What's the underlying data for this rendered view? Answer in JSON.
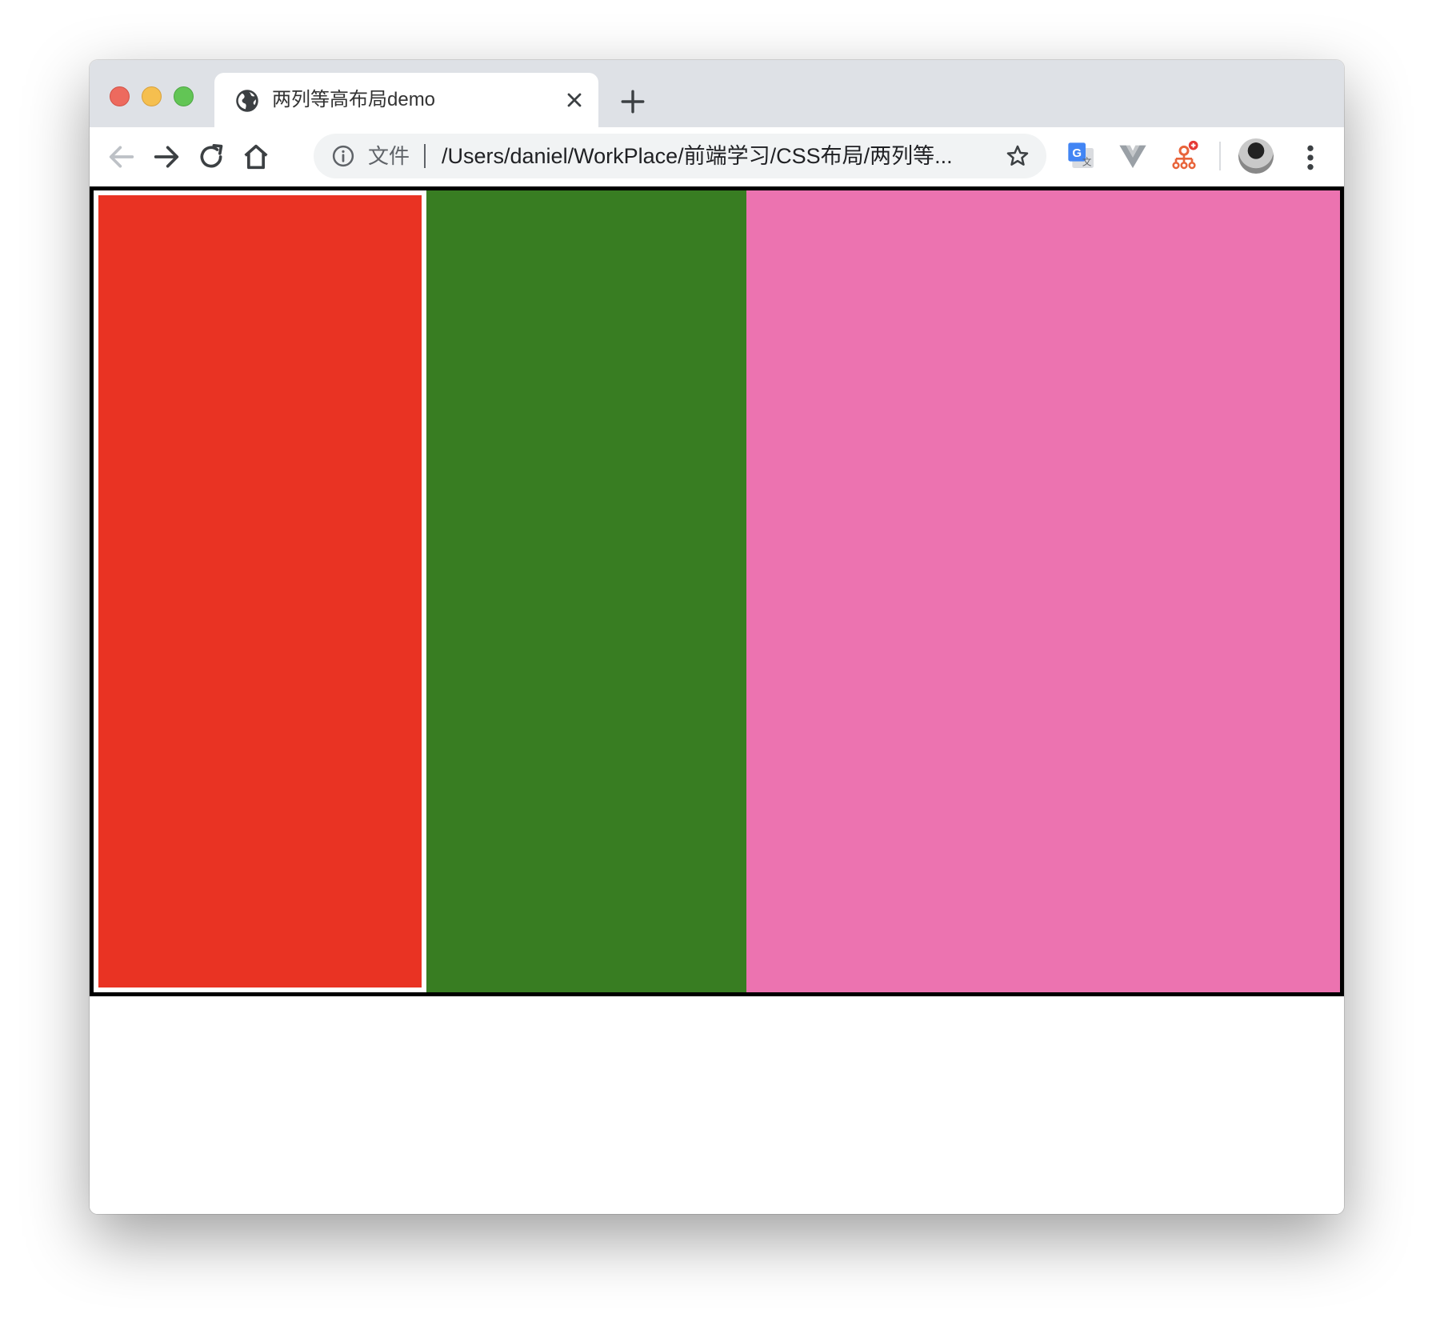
{
  "tab": {
    "title": "两列等高布局demo"
  },
  "omnibox": {
    "scheme": "文件",
    "url": "/Users/daniel/WorkPlace/前端学习/CSS布局/两列等..."
  },
  "toolbar": {
    "icons": [
      "back-icon",
      "forward-icon",
      "reload-icon",
      "home-icon",
      "info-icon",
      "star-icon",
      "google-translate-icon",
      "vue-devtools-icon",
      "extension-icon",
      "avatar",
      "menu-icon"
    ]
  },
  "colors": {
    "column_left": "#e93323",
    "column_middle": "#387d22",
    "column_right": "#ec73b0",
    "container_border": "#000000"
  }
}
